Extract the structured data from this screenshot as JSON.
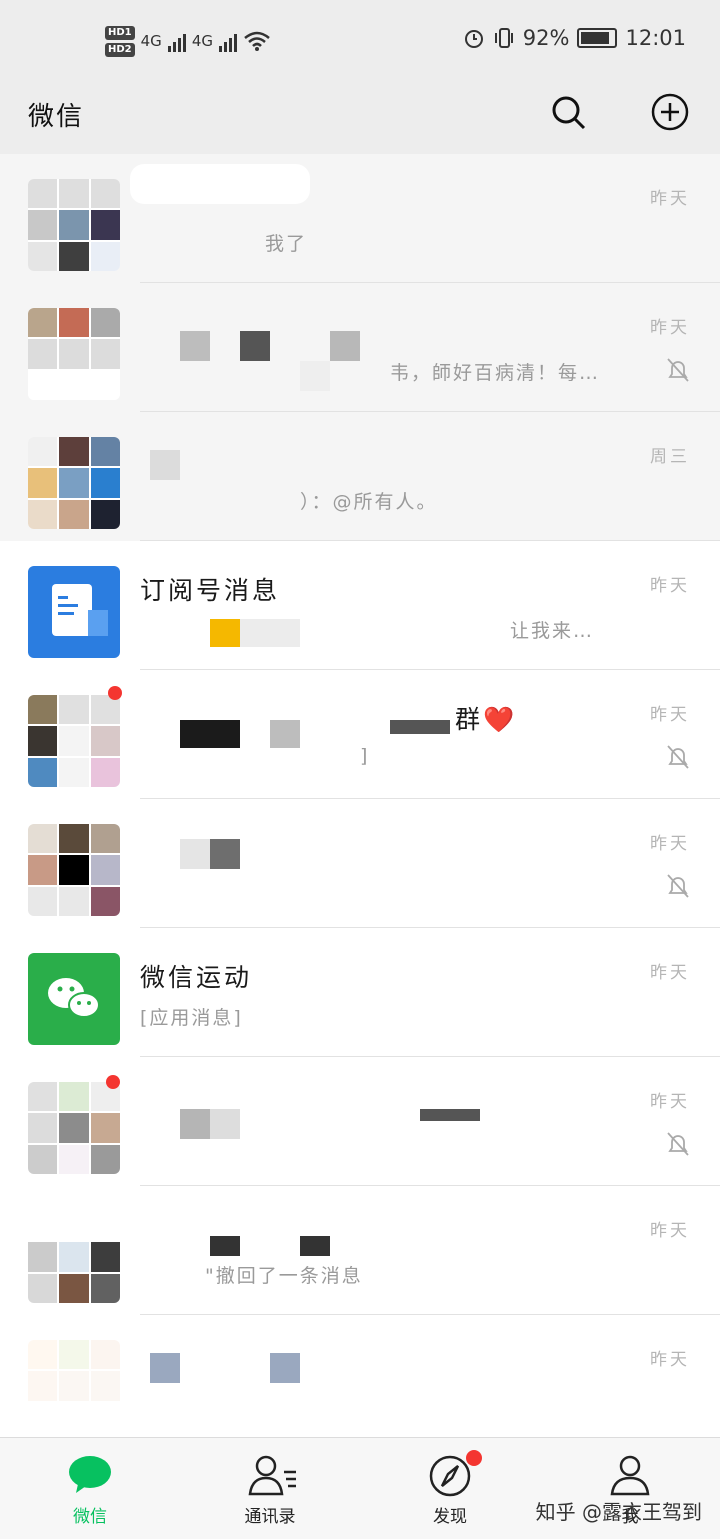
{
  "status": {
    "network": "4G",
    "battery": "92%",
    "time": "12:01"
  },
  "header": {
    "title": "微信"
  },
  "chats": [
    {
      "name": "",
      "preview": "我了",
      "time": "昨天"
    },
    {
      "name": "",
      "preview": "韦，師好百病清！每…",
      "time": "昨天"
    },
    {
      "name": "",
      "preview": "）：@所有人。",
      "time": "周三"
    },
    {
      "name": "订阅号消息",
      "preview": "让我来…",
      "time": "昨天"
    },
    {
      "name": "群❤️",
      "preview": "]",
      "time": "昨天"
    },
    {
      "name": "",
      "preview": "",
      "time": "昨天"
    },
    {
      "name": "微信运动",
      "preview": "[应用消息]",
      "time": "昨天"
    },
    {
      "name": "",
      "preview": "",
      "time": "昨天"
    },
    {
      "name": "",
      "preview": "\"撤回了一条消息",
      "time": "昨天"
    },
    {
      "name": "",
      "preview": "",
      "time": "昨天"
    }
  ],
  "tabs": [
    {
      "label": "微信",
      "active": true
    },
    {
      "label": "通讯录",
      "active": false
    },
    {
      "label": "发现",
      "active": false
    },
    {
      "label": "我",
      "active": false
    }
  ],
  "watermark": "知乎 @露衣王驾到",
  "colors": {
    "accent": "#07c160",
    "badge": "#f43530",
    "background": "#ededed"
  }
}
